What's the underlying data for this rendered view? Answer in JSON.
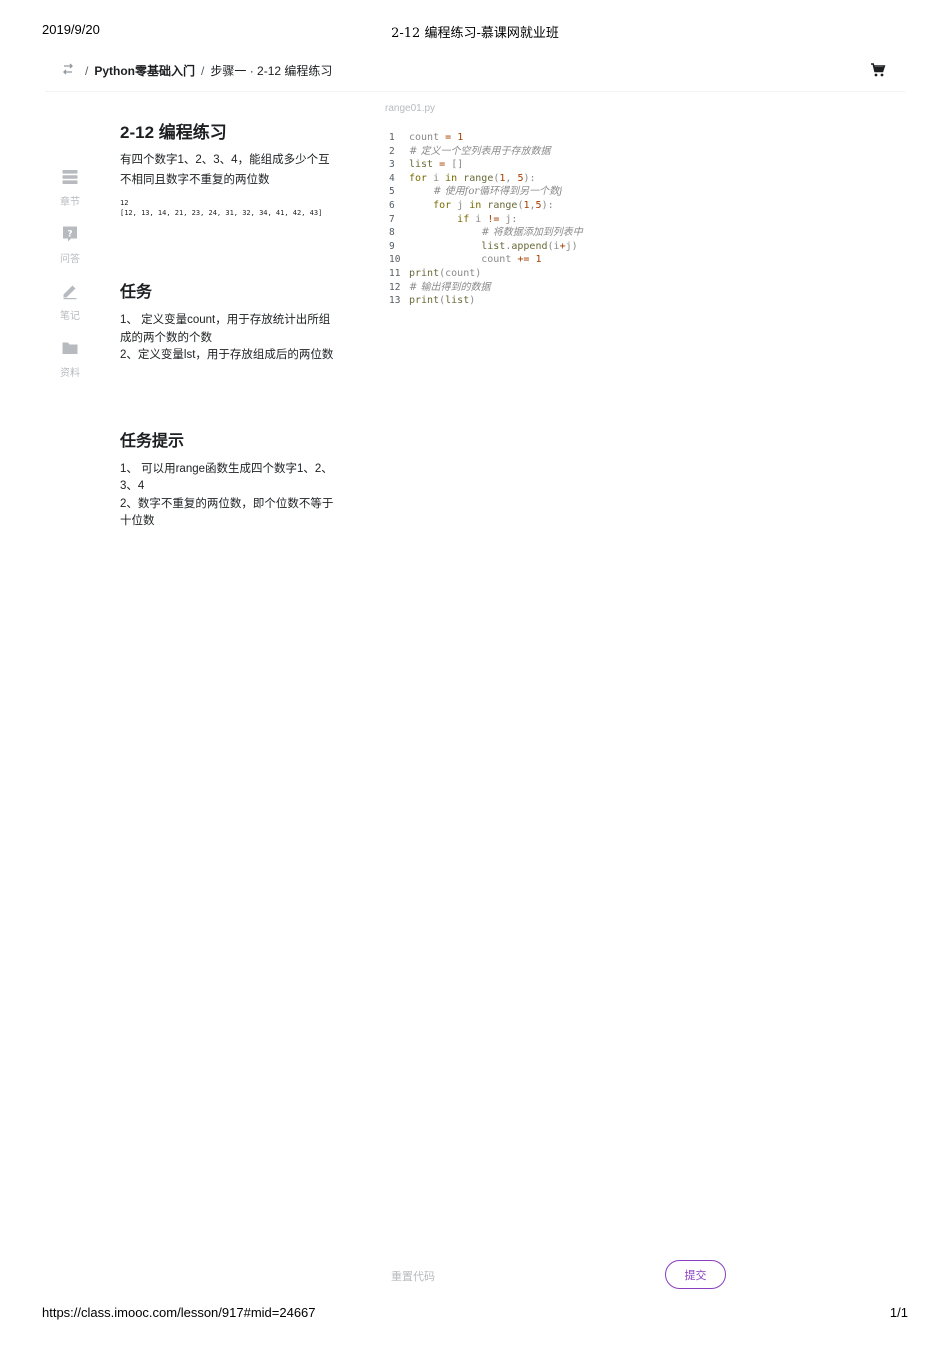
{
  "print_header": {
    "date": "2019/9/20",
    "title": "2-12 编程练习-慕课网就业班"
  },
  "print_footer": {
    "url": "https://class.imooc.com/lesson/917#mid=24667",
    "page": "1/1"
  },
  "topbar": {
    "back_icon": "switch-arrows-icon",
    "breadcrumb": {
      "sep": "/",
      "course": "Python零基础入门",
      "step": "步骤一 · 2-12 编程练习"
    },
    "cart_icon": "shopping-cart-icon"
  },
  "sidenav": {
    "items": [
      {
        "label": "章节",
        "icon": "chapters-icon"
      },
      {
        "label": "问答",
        "icon": "question-icon"
      },
      {
        "label": "笔记",
        "icon": "pencil-icon"
      },
      {
        "label": "资料",
        "icon": "folder-icon"
      }
    ]
  },
  "lesson": {
    "title": "2-12 编程练习",
    "description": "有四个数字1、2、3、4，能组成多少个互不相同且数字不重复的两位数",
    "output_line1": "12",
    "output_line2": "[12, 13, 14, 21, 23, 24, 31, 32, 34, 41, 42, 43]",
    "task_heading": "任务",
    "tasks": [
      "1、 定义变量count，用于存放统计出所组成的两个数的个数",
      "2、定义变量lst，用于存放组成后的两位数"
    ],
    "hint_heading": "任务提示",
    "hints": [
      "1、 可以用range函数生成四个数字1、2、3、4",
      "2、数字不重复的两位数，即个位数不等于十位数"
    ]
  },
  "editor": {
    "filename": "range01.py",
    "lines": [
      "count = 1",
      "# 定义一个空列表用于存放数据",
      "list = []",
      "for i in range(1, 5):",
      "    # 使用for循环得到另一个数j",
      "    for j in range(1,5):",
      "        if i != j:",
      "            # 将数据添加到列表中",
      "            list.append(i+j)",
      "            count += 1",
      "print(count)",
      "# 输出得到的数据",
      "print(list)"
    ]
  },
  "actions": {
    "reset_label": "重置代码",
    "submit_label": "提交"
  },
  "colors": {
    "accent": "#8a3fc2",
    "muted": "#b7bbbf",
    "text": "#1c1f21"
  }
}
